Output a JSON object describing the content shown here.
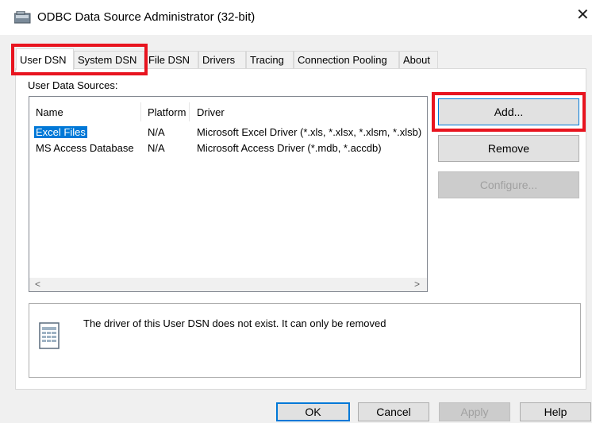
{
  "window": {
    "title": "ODBC Data Source Administrator (32-bit)",
    "close_glyph": "✕"
  },
  "tabs": [
    {
      "label": "User DSN",
      "active": true
    },
    {
      "label": "System DSN",
      "active": false
    },
    {
      "label": "File DSN",
      "active": false
    },
    {
      "label": "Drivers",
      "active": false
    },
    {
      "label": "Tracing",
      "active": false
    },
    {
      "label": "Connection Pooling",
      "active": false
    },
    {
      "label": "About",
      "active": false
    }
  ],
  "user_dsn": {
    "section_label": "User Data Sources:",
    "columns": [
      "Name",
      "Platform",
      "Driver"
    ],
    "rows": [
      {
        "name": "Excel Files",
        "platform": "N/A",
        "driver": "Microsoft Excel Driver (*.xls, *.xlsx, *.xlsm, *.xlsb)",
        "selected": true
      },
      {
        "name": "MS Access Database",
        "platform": "N/A",
        "driver": "Microsoft Access Driver (*.mdb, *.accdb)",
        "selected": false
      }
    ],
    "scroll_left": "<",
    "scroll_right": ">",
    "buttons": {
      "add": "Add...",
      "remove": "Remove",
      "configure": "Configure..."
    },
    "message": "The driver of this User DSN does not exist. It can only be removed"
  },
  "footer": {
    "ok": "OK",
    "cancel": "Cancel",
    "apply": "Apply",
    "help": "Help"
  },
  "colors": {
    "highlight": "#e8141f",
    "selection": "#0078d7",
    "dialog_bg": "#f0f0f0"
  },
  "icons": {
    "app": "odbc-admin-icon",
    "message": "datasource-document-icon"
  }
}
